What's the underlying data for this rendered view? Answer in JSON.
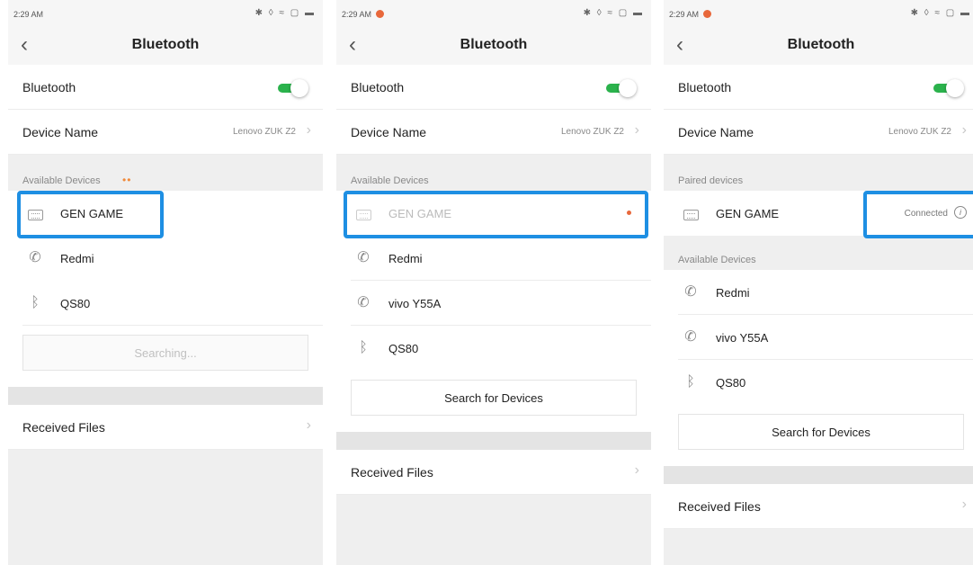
{
  "screens": [
    {
      "time": "2:29 AM",
      "title": "Bluetooth",
      "bluetooth_label": "Bluetooth",
      "device_name_label": "Device Name",
      "device_name_value": "Lenovo ZUK Z2",
      "section_label": "Available Devices",
      "section_dots": "••",
      "devices": [
        "GEN GAME",
        "Redmi",
        "QS80"
      ],
      "search_label": "Searching...",
      "received_files_label": "Received Files"
    },
    {
      "time": "2:29 AM",
      "title": "Bluetooth",
      "bluetooth_label": "Bluetooth",
      "device_name_label": "Device Name",
      "device_name_value": "Lenovo ZUK Z2",
      "section_label": "Available Devices",
      "devices": [
        "GEN GAME",
        "Redmi",
        "vivo Y55A",
        "QS80"
      ],
      "search_label": "Search for Devices",
      "received_files_label": "Received Files"
    },
    {
      "time": "2:29 AM",
      "title": "Bluetooth",
      "bluetooth_label": "Bluetooth",
      "device_name_label": "Device Name",
      "device_name_value": "Lenovo ZUK Z2",
      "paired_label": "Paired devices",
      "paired_device": "GEN GAME",
      "paired_status": "Connected",
      "section_label": "Available Devices",
      "devices": [
        "Redmi",
        "vivo Y55A",
        "QS80"
      ],
      "search_label": "Search for Devices",
      "received_files_label": "Received Files"
    }
  ],
  "icons": {
    "back": "‹",
    "chevron": "›",
    "phone": "✆",
    "bluetooth": "ᛒ",
    "info": "i"
  },
  "colors": {
    "accent_green": "#2bb24c",
    "highlight_blue": "#1e8fe3",
    "notification": "#e8683b"
  }
}
